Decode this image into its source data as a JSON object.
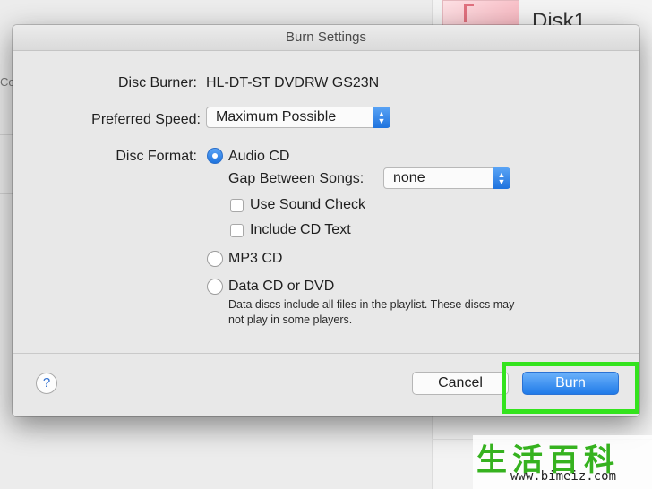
{
  "background": {
    "left_sidebar_text": "Co",
    "right_title": "Disk1"
  },
  "dialog": {
    "title": "Burn Settings",
    "disc_burner": {
      "label": "Disc Burner:",
      "value": "HL-DT-ST DVDRW  GS23N"
    },
    "preferred_speed": {
      "label": "Preferred Speed:",
      "value": "Maximum Possible"
    },
    "disc_format": {
      "label": "Disc Format:",
      "options": [
        {
          "label": "Audio CD",
          "selected": true
        },
        {
          "label": "MP3 CD",
          "selected": false
        },
        {
          "label": "Data CD or DVD",
          "selected": false
        }
      ],
      "gap_between_songs": {
        "label": "Gap Between Songs:",
        "value": "none"
      },
      "use_sound_check": {
        "label": "Use Sound Check",
        "checked": false
      },
      "include_cd_text": {
        "label": "Include CD Text",
        "checked": false
      },
      "data_note": "Data discs include all files in the playlist. These discs may not play in some players."
    },
    "help_label": "?",
    "cancel_label": "Cancel",
    "burn_label": "Burn"
  },
  "watermark": {
    "chars": "生活百科",
    "url": "www.bimeiz.com"
  },
  "colors": {
    "accent_blue": "#1e73de",
    "highlight_green": "#33e31d"
  }
}
